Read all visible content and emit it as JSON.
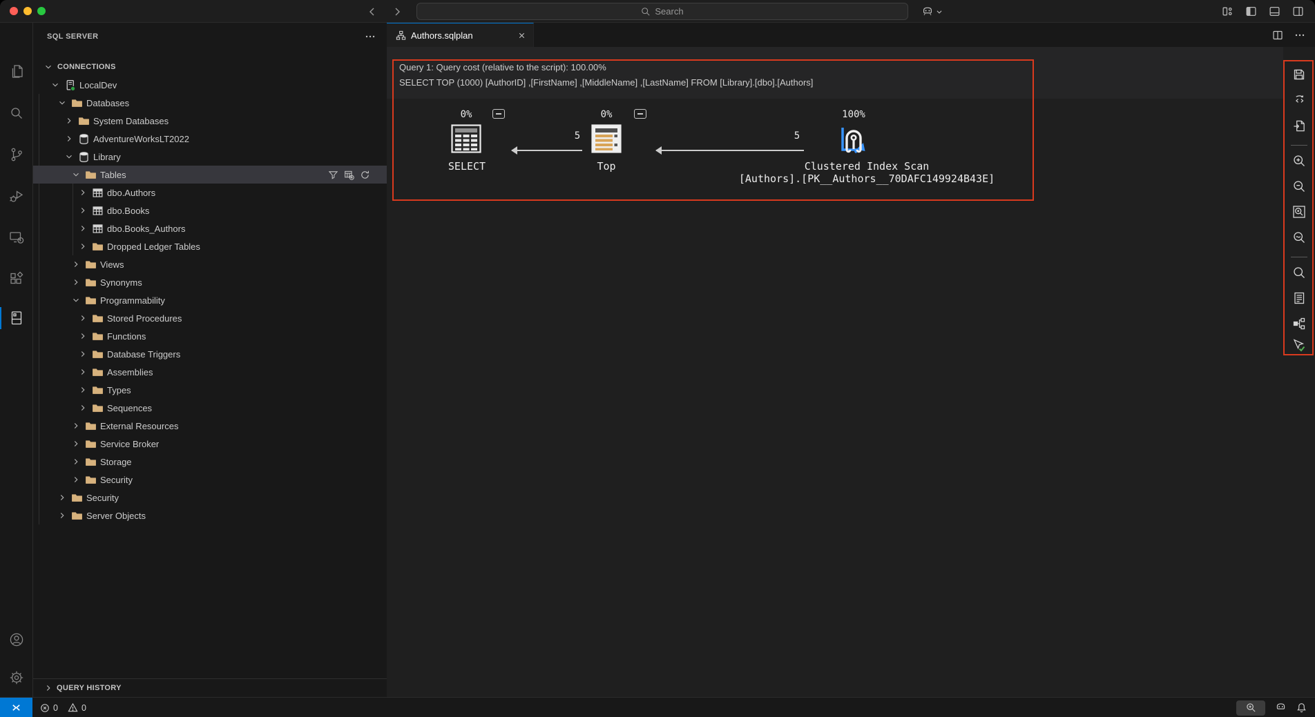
{
  "titlebar": {
    "search_placeholder": "Search"
  },
  "activity_bar": {
    "items": [
      "explorer-icon",
      "search-icon",
      "source-control-icon",
      "run-debug-icon",
      "remote-explorer-icon",
      "extensions-icon",
      "sql-server-icon"
    ],
    "active_index": 6,
    "bottom_items": [
      "accounts-icon",
      "settings-gear-icon"
    ]
  },
  "sidebar": {
    "title": "SQL SERVER",
    "query_history_label": "QUERY HISTORY",
    "tree": [
      {
        "label": "CONNECTIONS",
        "level": 0,
        "chevron": "down",
        "icon": null,
        "section": true
      },
      {
        "label": "LocalDev",
        "level": 1,
        "chevron": "down",
        "icon": "server"
      },
      {
        "label": "Databases",
        "level": 2,
        "chevron": "down",
        "icon": "folder"
      },
      {
        "label": "System Databases",
        "level": 3,
        "chevron": "right",
        "icon": "folder"
      },
      {
        "label": "AdventureWorksLT2022",
        "level": 3,
        "chevron": "right",
        "icon": "database"
      },
      {
        "label": "Library",
        "level": 3,
        "chevron": "down",
        "icon": "database"
      },
      {
        "label": "Tables",
        "level": 4,
        "chevron": "down",
        "icon": "folder",
        "selected": true,
        "actions": [
          "filter-icon",
          "new-table-icon",
          "refresh-icon"
        ]
      },
      {
        "label": "dbo.Authors",
        "level": 5,
        "chevron": "right",
        "icon": "table"
      },
      {
        "label": "dbo.Books",
        "level": 5,
        "chevron": "right",
        "icon": "table"
      },
      {
        "label": "dbo.Books_Authors",
        "level": 5,
        "chevron": "right",
        "icon": "table"
      },
      {
        "label": "Dropped Ledger Tables",
        "level": 5,
        "chevron": "right",
        "icon": "folder"
      },
      {
        "label": "Views",
        "level": 4,
        "chevron": "right",
        "icon": "folder"
      },
      {
        "label": "Synonyms",
        "level": 4,
        "chevron": "right",
        "icon": "folder"
      },
      {
        "label": "Programmability",
        "level": 4,
        "chevron": "down",
        "icon": "folder"
      },
      {
        "label": "Stored Procedures",
        "level": 5,
        "chevron": "right",
        "icon": "folder"
      },
      {
        "label": "Functions",
        "level": 5,
        "chevron": "right",
        "icon": "folder"
      },
      {
        "label": "Database Triggers",
        "level": 5,
        "chevron": "right",
        "icon": "folder"
      },
      {
        "label": "Assemblies",
        "level": 5,
        "chevron": "right",
        "icon": "folder"
      },
      {
        "label": "Types",
        "level": 5,
        "chevron": "right",
        "icon": "folder"
      },
      {
        "label": "Sequences",
        "level": 5,
        "chevron": "right",
        "icon": "folder"
      },
      {
        "label": "External Resources",
        "level": 4,
        "chevron": "right",
        "icon": "folder"
      },
      {
        "label": "Service Broker",
        "level": 4,
        "chevron": "right",
        "icon": "folder"
      },
      {
        "label": "Storage",
        "level": 4,
        "chevron": "right",
        "icon": "folder"
      },
      {
        "label": "Security",
        "level": 4,
        "chevron": "right",
        "icon": "folder"
      },
      {
        "label": "Security",
        "level": 2,
        "chevron": "right",
        "icon": "folder"
      },
      {
        "label": "Server Objects",
        "level": 2,
        "chevron": "right",
        "icon": "folder"
      }
    ]
  },
  "editor": {
    "tab": {
      "title": "Authors.sqlplan",
      "icon": "execution-plan-icon"
    },
    "plan": {
      "header_line1": "Query 1: Query cost (relative to the script): 100.00%",
      "header_line2": "SELECT TOP (1000) [AuthorID] ,[FirstName] ,[MiddleName] ,[LastName] FROM [Library].[dbo].[Authors]",
      "nodes": [
        {
          "cost": "0%",
          "label": "SELECT"
        },
        {
          "cost": "0%",
          "label": "Top"
        },
        {
          "cost": "100%",
          "label": "Clustered Index Scan",
          "sublabel": "[Authors].[PK__Authors__70DAFC149924B43E]"
        }
      ],
      "edges": [
        {
          "rows": "5"
        },
        {
          "rows": "5"
        }
      ]
    },
    "toolbar_icons": [
      "save-plan-icon",
      "show-query-icon",
      "open-plan-file-icon",
      "zoom-in-icon",
      "zoom-out-icon",
      "zoom-to-fit-icon",
      "custom-zoom-icon",
      "find-node-icon",
      "properties-icon",
      "compare-plan-icon",
      "actual-plan-icon"
    ]
  },
  "status_bar": {
    "errors": "0",
    "warnings": "0",
    "right_icons": [
      "zoom-indicator-icon",
      "copilot-icon",
      "notifications-bell-icon"
    ]
  },
  "colors": {
    "accent": "#0078d4",
    "highlight_border": "#d93a1e",
    "folder": "#d7b27d",
    "connection_ok": "#2ea043",
    "traffic_red": "#ff5f57",
    "traffic_yellow": "#febc2e",
    "traffic_green": "#28c840"
  }
}
